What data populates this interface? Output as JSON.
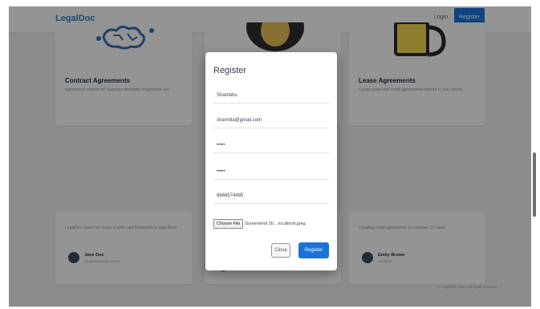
{
  "navbar": {
    "brand": "LegalDoc",
    "login_label": "Login",
    "register_label": "Register"
  },
  "cards": [
    {
      "title": "Contract Agreements",
      "text": "Agreement contract for business formation of personal use.",
      "icon": "circuit-brain-icon"
    },
    {
      "title": "",
      "text": "",
      "icon": "person-icon"
    },
    {
      "title": "Lease Agreements",
      "text": "Create lease and rental agreements tailored to your needs.",
      "icon": "mug-icon"
    }
  ],
  "testimonials": [
    {
      "quote": "LegalDoc saved me hours of work and thousands in legal fees!",
      "name": "Jane Doe",
      "role": "Small Business Owner"
    },
    {
      "quote": "",
      "name": "",
      "role": ""
    },
    {
      "quote": "Creating rental agreements is a breeze. 10 stars!",
      "name": "Emily Brown",
      "role": "Landlord"
    }
  ],
  "footer": {
    "text": "© LegalDoc 2024. All rights reserved."
  },
  "modal": {
    "title": "Register",
    "name_value": "Shambhu",
    "email_value": "sharmila@gmail.com",
    "password_value": "•••••",
    "confirm_password_value": "•••••",
    "phone_value": "8668574485",
    "file_button_label": "Choose File",
    "file_name": "Screenshot 20... localhost.jpeg",
    "close_label": "Close",
    "register_label": "Register"
  },
  "colors": {
    "primary": "#1a73d9",
    "brand": "#3b7fc4",
    "overlay": "rgba(0,0,0,0.42)"
  }
}
